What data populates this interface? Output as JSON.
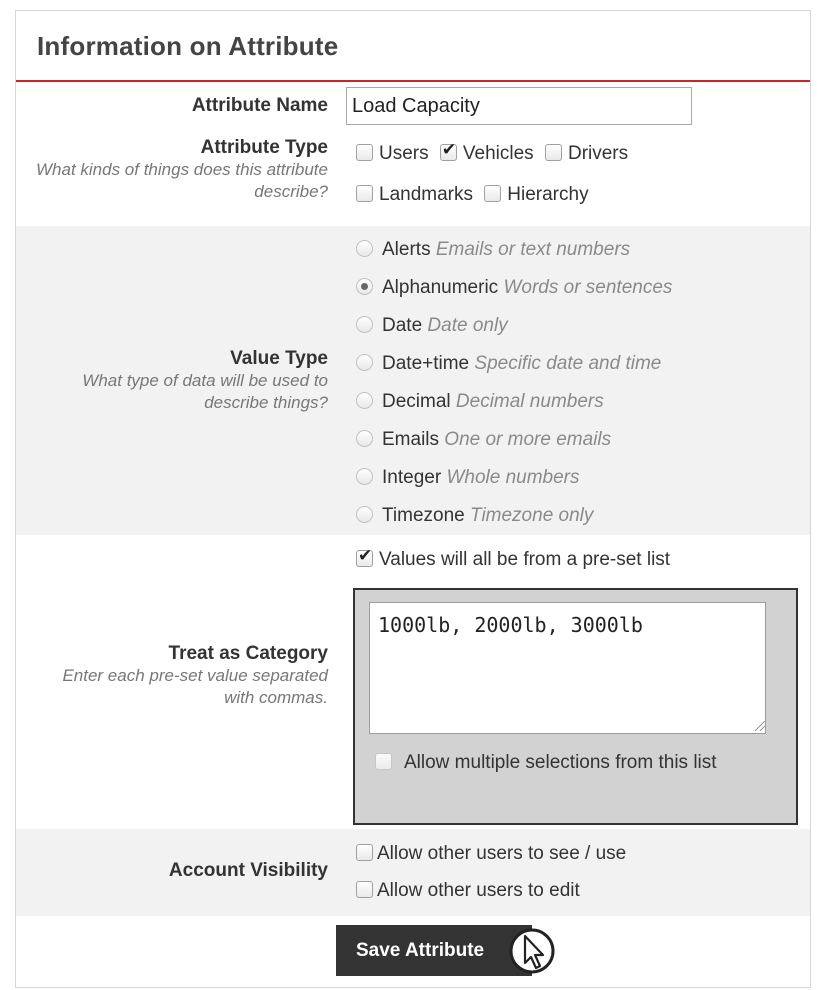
{
  "panel": {
    "title": "Information on Attribute"
  },
  "attribute_name": {
    "label": "Attribute Name",
    "value": "Load Capacity"
  },
  "attribute_type": {
    "label": "Attribute Type",
    "help": "What kinds of things does this attribute describe?",
    "options": [
      {
        "label": "Users",
        "checked": false
      },
      {
        "label": "Vehicles",
        "checked": true
      },
      {
        "label": "Drivers",
        "checked": false
      },
      {
        "label": "Landmarks",
        "checked": false
      },
      {
        "label": "Hierarchy",
        "checked": false
      }
    ]
  },
  "value_type": {
    "label": "Value Type",
    "help": "What type of data will be used to describe things?",
    "selected": "Alphanumeric",
    "options": [
      {
        "name": "Alerts",
        "desc": "Emails or text numbers"
      },
      {
        "name": "Alphanumeric",
        "desc": "Words or sentences"
      },
      {
        "name": "Date",
        "desc": "Date only"
      },
      {
        "name": "Date+time",
        "desc": "Specific date and time"
      },
      {
        "name": "Decimal",
        "desc": "Decimal numbers"
      },
      {
        "name": "Emails",
        "desc": "One or more emails"
      },
      {
        "name": "Integer",
        "desc": "Whole numbers"
      },
      {
        "name": "Timezone",
        "desc": "Timezone only"
      }
    ]
  },
  "category": {
    "label": "Treat as Category",
    "help": "Enter each pre-set value separated with commas.",
    "preset_label": "Values will all be from a pre-set list",
    "preset_checked": true,
    "values_text": "1000lb, 2000lb, 3000lb",
    "multi_label": "Allow multiple selections from this list",
    "multi_checked": false
  },
  "visibility": {
    "label": "Account Visibility",
    "see_label": "Allow other users to see / use",
    "edit_label": "Allow other users to edit"
  },
  "save_button": {
    "label": "Save Attribute"
  },
  "colors": {
    "accent": "#c8272b",
    "button": "#333333",
    "alt_row": "#f2f2f2"
  }
}
